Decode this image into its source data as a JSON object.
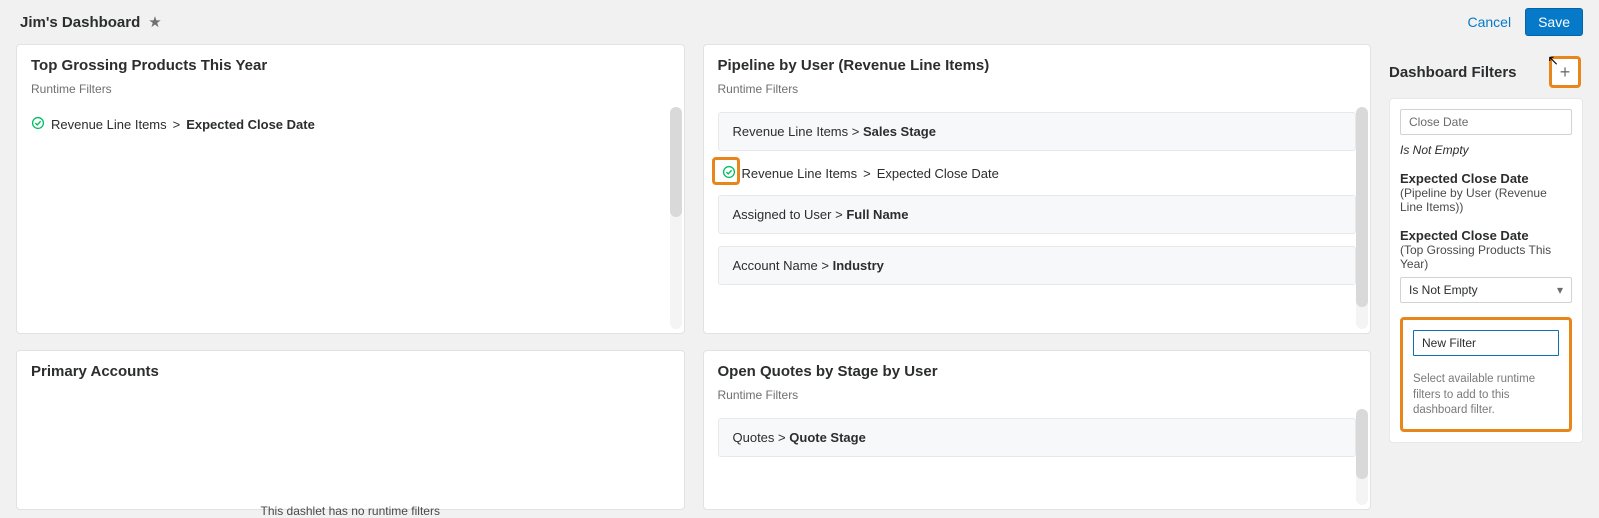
{
  "header": {
    "title": "Jim's Dashboard",
    "cancel": "Cancel",
    "save": "Save"
  },
  "runtime_filters_label": "Runtime Filters",
  "panels": {
    "top_grossing": {
      "title": "Top Grossing Products This Year",
      "filters": [
        {
          "module": "Revenue Line Items",
          "field": "Expected Close Date",
          "checked": true
        }
      ]
    },
    "pipeline": {
      "title": "Pipeline by User (Revenue Line Items)",
      "rows": [
        {
          "module": "Revenue Line Items",
          "field": "Sales Stage"
        }
      ],
      "selected": {
        "module": "Revenue Line Items",
        "field": "Expected Close Date"
      },
      "rows2": [
        {
          "module": "Assigned to User",
          "field": "Full Name"
        },
        {
          "module": "Account Name",
          "field": "Industry"
        }
      ]
    },
    "primary_accounts": {
      "title": "Primary Accounts",
      "empty": "This dashlet has no runtime filters"
    },
    "open_quotes": {
      "title": "Open Quotes by Stage by User",
      "rows": [
        {
          "module": "Quotes",
          "field": "Quote Stage"
        }
      ]
    }
  },
  "dashboard_filters": {
    "title": "Dashboard Filters",
    "close_date_label": "Close Date",
    "not_empty_text": "Is Not Empty",
    "group1": {
      "heading": "Expected Close Date",
      "sub": "(Pipeline by User (Revenue Line Items))"
    },
    "group2": {
      "heading": "Expected Close Date",
      "sub": "(Top Grossing Products This Year)"
    },
    "select_value": "Is Not Empty",
    "new_filter_value": "New Filter",
    "help": "Select available runtime filters to add to this dashboard filter."
  },
  "sep": " > "
}
